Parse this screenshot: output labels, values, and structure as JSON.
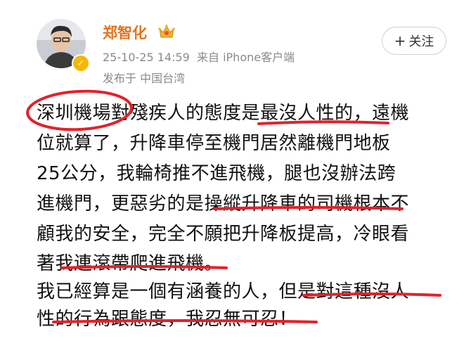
{
  "author": {
    "name": "郑智化",
    "avatar_icon": "person-avatar",
    "verified_icon": "verified-badge-icon",
    "badge_icon": "crown-badge-icon"
  },
  "post_meta": {
    "timestamp": "25-10-25 14:59",
    "source": "来自 iPhone客户端",
    "location": "发布于 中国台湾"
  },
  "follow_button": {
    "plus": "+",
    "label": "关注"
  },
  "post_lines": [
    "深圳機場對殘疾人的態度是最沒人性的，遠機",
    "位就算了，升降車停至機門居然離機門地板",
    "25公分，我輪椅推不進飛機，腿也沒辦法跨",
    "進機門，更惡劣的是操縱升降車的司機根本不",
    "顧我的安全，完全不願把升降板提高，冷眼看",
    "著我連滾帶爬進飛機。",
    "我已經算是一個有涵養的人，但是對這種沒人",
    "性的行為跟態度，我忍無可忍！"
  ],
  "colors": {
    "name": "#e8721c",
    "meta": "#8a8a8a",
    "annotation": "#e5202a",
    "verified": "#f6b700"
  }
}
